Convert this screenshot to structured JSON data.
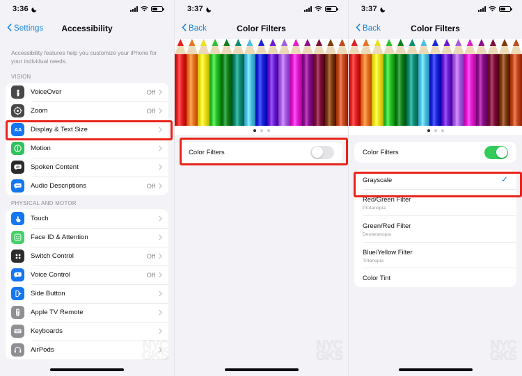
{
  "watermark": "NYC\nGKS",
  "panels": [
    {
      "id": "accessibility",
      "statusbar": {
        "time": "3:36",
        "moon_icon": "crescent-moon-icon",
        "cellular_icon": "cellular-signal-icon",
        "wifi_icon": "wifi-icon",
        "battery_icon": "battery-icon"
      },
      "nav": {
        "back_label": "Settings",
        "title": "Accessibility",
        "back_icon": "chevron-left-icon"
      },
      "intro": "Accessibility features help you customize your iPhone for your individual needs.",
      "sections": [
        {
          "header": "VISION",
          "items": [
            {
              "label": "VoiceOver",
              "value": "Off",
              "icon": "voiceover-icon",
              "icon_color": "#48484a",
              "chevron": "chevron-right-icon"
            },
            {
              "label": "Zoom",
              "value": "Off",
              "icon": "zoom-icon",
              "icon_color": "#48484a",
              "chevron": "chevron-right-icon"
            },
            {
              "label": "Display & Text Size",
              "value": "",
              "icon": "display-text-size-icon",
              "icon_color": "#1476f0",
              "chevron": "chevron-right-icon",
              "highlighted": true
            },
            {
              "label": "Motion",
              "value": "",
              "icon": "motion-icon",
              "icon_color": "#2fc25b",
              "chevron": "chevron-right-icon"
            },
            {
              "label": "Spoken Content",
              "value": "",
              "icon": "spoken-content-icon",
              "icon_color": "#2c2c2e",
              "chevron": "chevron-right-icon"
            },
            {
              "label": "Audio Descriptions",
              "value": "Off",
              "icon": "audio-descriptions-icon",
              "icon_color": "#1476f0",
              "chevron": "chevron-right-icon"
            }
          ]
        },
        {
          "header": "PHYSICAL AND MOTOR",
          "items": [
            {
              "label": "Touch",
              "value": "",
              "icon": "touch-icon",
              "icon_color": "#1476f0",
              "chevron": "chevron-right-icon"
            },
            {
              "label": "Face ID & Attention",
              "value": "",
              "icon": "face-id-icon",
              "icon_color": "#45d06a",
              "chevron": "chevron-right-icon"
            },
            {
              "label": "Switch Control",
              "value": "Off",
              "icon": "switch-control-icon",
              "icon_color": "#2c2c2e",
              "chevron": "chevron-right-icon"
            },
            {
              "label": "Voice Control",
              "value": "Off",
              "icon": "voice-control-icon",
              "icon_color": "#1476f0",
              "chevron": "chevron-right-icon"
            },
            {
              "label": "Side Button",
              "value": "",
              "icon": "side-button-icon",
              "icon_color": "#1476f0",
              "chevron": "chevron-right-icon"
            },
            {
              "label": "Apple TV Remote",
              "value": "",
              "icon": "apple-tv-remote-icon",
              "icon_color": "#8e8e93",
              "chevron": "chevron-right-icon"
            },
            {
              "label": "Keyboards",
              "value": "",
              "icon": "keyboards-icon",
              "icon_color": "#8e8e93",
              "chevron": "chevron-right-icon"
            },
            {
              "label": "AirPods",
              "value": "",
              "icon": "airpods-icon",
              "icon_color": "#8e8e93",
              "chevron": "chevron-right-icon"
            }
          ]
        }
      ]
    },
    {
      "id": "color-filters-off",
      "statusbar": {
        "time": "3:37",
        "moon_icon": "crescent-moon-icon",
        "cellular_icon": "cellular-signal-icon",
        "wifi_icon": "wifi-icon",
        "battery_icon": "battery-icon"
      },
      "nav": {
        "back_label": "Back",
        "title": "Color Filters",
        "back_icon": "chevron-left-icon"
      },
      "preview": {
        "name": "colored-pencils-preview",
        "page_dots": 3,
        "active_dot": 1
      },
      "toggle": {
        "label": "Color Filters",
        "state": "off",
        "highlighted": true
      },
      "filters": []
    },
    {
      "id": "color-filters-on",
      "statusbar": {
        "time": "3:37",
        "moon_icon": "crescent-moon-icon",
        "cellular_icon": "cellular-signal-icon",
        "wifi_icon": "wifi-icon",
        "battery_icon": "battery-icon"
      },
      "nav": {
        "back_label": "Back",
        "title": "Color Filters",
        "back_icon": "chevron-left-icon"
      },
      "preview": {
        "name": "colored-pencils-preview",
        "page_dots": 3,
        "active_dot": 1
      },
      "toggle": {
        "label": "Color Filters",
        "state": "on",
        "highlighted": false
      },
      "filters": [
        {
          "name": "Grayscale",
          "sub": "",
          "selected": true,
          "highlighted": true
        },
        {
          "name": "Red/Green Filter",
          "sub": "Protanopia",
          "selected": false,
          "highlighted": false
        },
        {
          "name": "Green/Red Filter",
          "sub": "Deuteranopia",
          "selected": false,
          "highlighted": false
        },
        {
          "name": "Blue/Yellow Filter",
          "sub": "Tritanopia",
          "selected": false,
          "highlighted": false
        },
        {
          "name": "Color Tint",
          "sub": "",
          "selected": false,
          "highlighted": false
        }
      ]
    }
  ],
  "colors": {
    "highlight_red": "#e8241a",
    "accent_blue": "#1784e0",
    "toggle_on_green": "#32cc59",
    "background": "#f2f2f7"
  },
  "pencil_colors": [
    "#e02020",
    "#e87424",
    "#ece01c",
    "#2fc02f",
    "#0f7c1e",
    "#0e8c78",
    "#4fbde0",
    "#1a26d8",
    "#6a1ed0",
    "#a45be0",
    "#e01ccc",
    "#8c0f8c",
    "#7a0f38",
    "#7a3c10",
    "#c04a20"
  ]
}
